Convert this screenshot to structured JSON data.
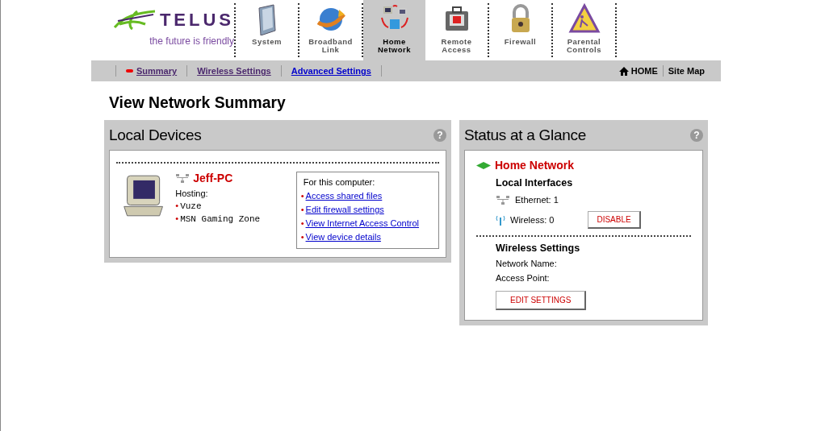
{
  "logo": {
    "brand": "TELUS",
    "tagline": "the future is friendly"
  },
  "tabs": [
    {
      "label": "System",
      "kind": "system",
      "selected": false
    },
    {
      "label": "Broadband Link",
      "kind": "globe",
      "selected": false
    },
    {
      "label": "Home Network",
      "kind": "network",
      "selected": true
    },
    {
      "label": "Remote Access",
      "kind": "briefcase",
      "selected": false
    },
    {
      "label": "Firewall",
      "kind": "lock",
      "selected": false
    },
    {
      "label": "Parental Controls",
      "kind": "warning",
      "selected": false
    }
  ],
  "subnav": [
    {
      "label": "Summary",
      "selected": true
    },
    {
      "label": "Wireless Settings",
      "selected": false
    },
    {
      "label": "Advanced Settings",
      "selected": false
    }
  ],
  "top_links": {
    "home": "HOME",
    "site_map": "Site Map"
  },
  "page_title": "View Network Summary",
  "local_devices": {
    "title": "Local Devices",
    "help": "?",
    "bullet": "•",
    "device": {
      "name": "Jeff-PC",
      "hosting_label": "Hosting:",
      "hosting": [
        "Vuze",
        "MSN Gaming Zone"
      ],
      "actions_title": "For this computer:",
      "actions": [
        "Access shared files",
        "Edit firewall settings",
        "View Internet Access Control",
        "View device details"
      ]
    }
  },
  "status": {
    "title": "Status at a Glance",
    "help": "?",
    "network": "Home Network",
    "interfaces_title": "Local Interfaces",
    "ethernet": "Ethernet: 1",
    "wireless": "Wireless: 0",
    "disable_button": "DISABLE",
    "wireless_title": "Wireless Settings",
    "network_name_label": "Network Name:",
    "access_point_label": "Access Point:",
    "edit_button": "EDIT SETTINGS"
  }
}
